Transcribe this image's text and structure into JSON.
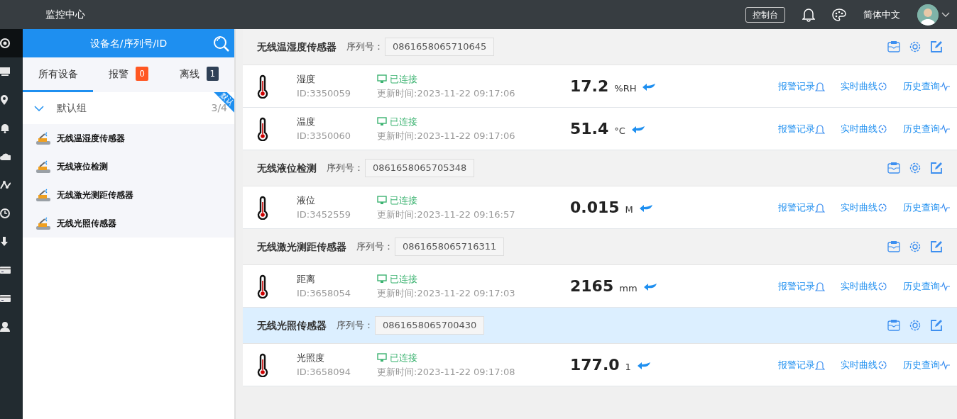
{
  "header": {
    "title": "监控中心",
    "console_button": "控制台",
    "language": "简体中文"
  },
  "rail": [
    {
      "kind": "target",
      "selected": true
    },
    {
      "kind": "monitor",
      "selected": false
    },
    {
      "kind": "pin",
      "selected": false
    },
    {
      "kind": "bell",
      "selected": false
    },
    {
      "kind": "cloud",
      "selected": false
    },
    {
      "kind": "graph",
      "selected": false
    },
    {
      "kind": "clock",
      "selected": false
    },
    {
      "kind": "download",
      "selected": false
    },
    {
      "kind": "card",
      "selected": false
    },
    {
      "kind": "card",
      "selected": false
    },
    {
      "kind": "user",
      "selected": false
    }
  ],
  "device_panel": {
    "search": {
      "placeholder": "设备名/序列号/ID"
    },
    "tabs": [
      {
        "label": "所有设备",
        "selected": true
      },
      {
        "label": "报警",
        "count": "0",
        "color": "#ff5722",
        "selected": false
      },
      {
        "label": "离线",
        "count": "1",
        "color": "#2f4056",
        "selected": false
      }
    ],
    "group": {
      "name": "默认组",
      "count": "3/4",
      "expanded": true,
      "ribbon": "默认"
    },
    "devices": [
      "无线温湿度传感器",
      "无线液位检测",
      "无线激光测距传感器",
      "无线光照传感器"
    ]
  },
  "sensor_groups": [
    {
      "name": "无线温湿度传感器",
      "serial_label": "序列号：",
      "serial": "0861658065710645",
      "selected": false,
      "channels": [
        {
          "name": "湿度",
          "id": "ID:3350059",
          "status": "已连接",
          "updated": "更新时间:2023-11-22 09:17:06",
          "value": "17.2",
          "unit": "%RH",
          "actions": [
            "报警记录",
            "实时曲线",
            "历史查询"
          ]
        },
        {
          "name": "温度",
          "id": "ID:3350060",
          "status": "已连接",
          "updated": "更新时间:2023-11-22 09:17:06",
          "value": "51.4",
          "unit": "°C",
          "actions": [
            "报警记录",
            "实时曲线",
            "历史查询"
          ]
        }
      ]
    },
    {
      "name": "无线液位检测",
      "serial_label": "序列号：",
      "serial": "0861658065705348",
      "selected": false,
      "channels": [
        {
          "name": "液位",
          "id": "ID:3452559",
          "status": "已连接",
          "updated": "更新时间:2023-11-22 09:16:57",
          "value": "0.015",
          "unit": "M",
          "actions": [
            "报警记录",
            "实时曲线",
            "历史查询"
          ]
        }
      ]
    },
    {
      "name": "无线激光测距传感器",
      "serial_label": "序列号：",
      "serial": "0861658065716311",
      "selected": false,
      "channels": [
        {
          "name": "距离",
          "id": "ID:3658054",
          "status": "已连接",
          "updated": "更新时间:2023-11-22 09:17:03",
          "value": "2165",
          "unit": "mm",
          "actions": [
            "报警记录",
            "实时曲线",
            "历史查询"
          ]
        }
      ]
    },
    {
      "name": "无线光照传感器",
      "serial_label": "序列号：",
      "serial": "0861658065700430",
      "selected": true,
      "channels": [
        {
          "name": "光照度",
          "id": "ID:3658094",
          "status": "已连接",
          "updated": "更新时间:2023-11-22 09:17:08",
          "value": "177.0",
          "unit": "1",
          "actions": [
            "报警记录",
            "实时曲线",
            "历史查询"
          ]
        }
      ]
    }
  ]
}
